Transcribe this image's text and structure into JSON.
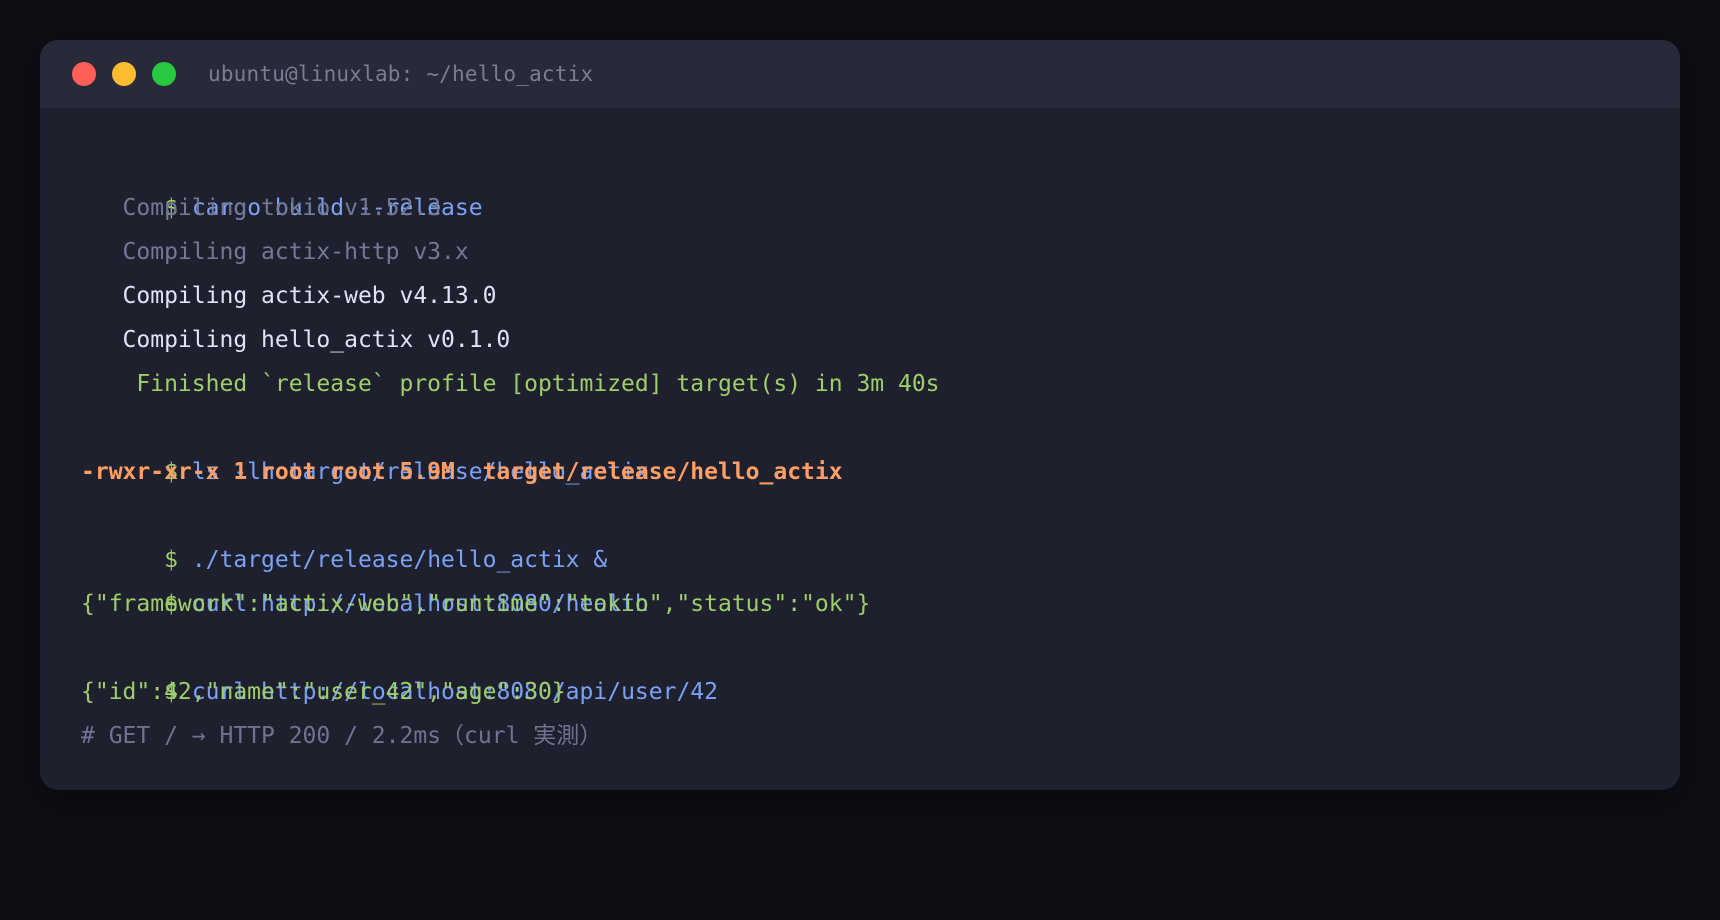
{
  "window": {
    "title": "ubuntu@linuxlab: ~/hello_actix",
    "controls": [
      "close",
      "minimize",
      "maximize"
    ]
  },
  "lines": [
    {
      "type": "command",
      "prompt": "$",
      "text": "cargo build --release"
    },
    {
      "type": "output-dim",
      "text": "   Compiling tokio v1.52.3"
    },
    {
      "type": "output-dim",
      "text": "   Compiling actix-http v3.x"
    },
    {
      "type": "output",
      "text": "   Compiling actix-web v4.13.0"
    },
    {
      "type": "output",
      "text": "   Compiling hello_actix v0.1.0"
    },
    {
      "type": "output-green",
      "text": "    Finished `release` profile [optimized] target(s) in 3m 40s"
    },
    {
      "type": "command",
      "prompt": "$",
      "text": "ls -lh target/release/hello_actix"
    },
    {
      "type": "output-orange",
      "text": "-rwxr-xr-x 1 root root 5.9M  target/release/hello_actix"
    },
    {
      "type": "command",
      "prompt": "$",
      "text": "./target/release/hello_actix &"
    },
    {
      "type": "command",
      "prompt": "$",
      "text": "curl http://localhost:8080/health"
    },
    {
      "type": "output-green",
      "text": "{\"framework\":\"actix-web\",\"runtime\":\"tokio\",\"status\":\"ok\"}"
    },
    {
      "type": "command",
      "prompt": "$",
      "text": "curl http://localhost:8080/api/user/42"
    },
    {
      "type": "output-green",
      "text": "{\"id\":42,\"name\":\"user_42\",\"age\":30}"
    },
    {
      "type": "comment",
      "text": "# GET / → HTTP 200 / 2.2ms（curl 実測）"
    }
  ],
  "colors": {
    "background": "#0e0f15",
    "window": "#1f202d",
    "titlebar": "#282a3a",
    "prompt": "#9ece6a",
    "command": "#7aa2f7",
    "highlight": "#ff9e64"
  }
}
